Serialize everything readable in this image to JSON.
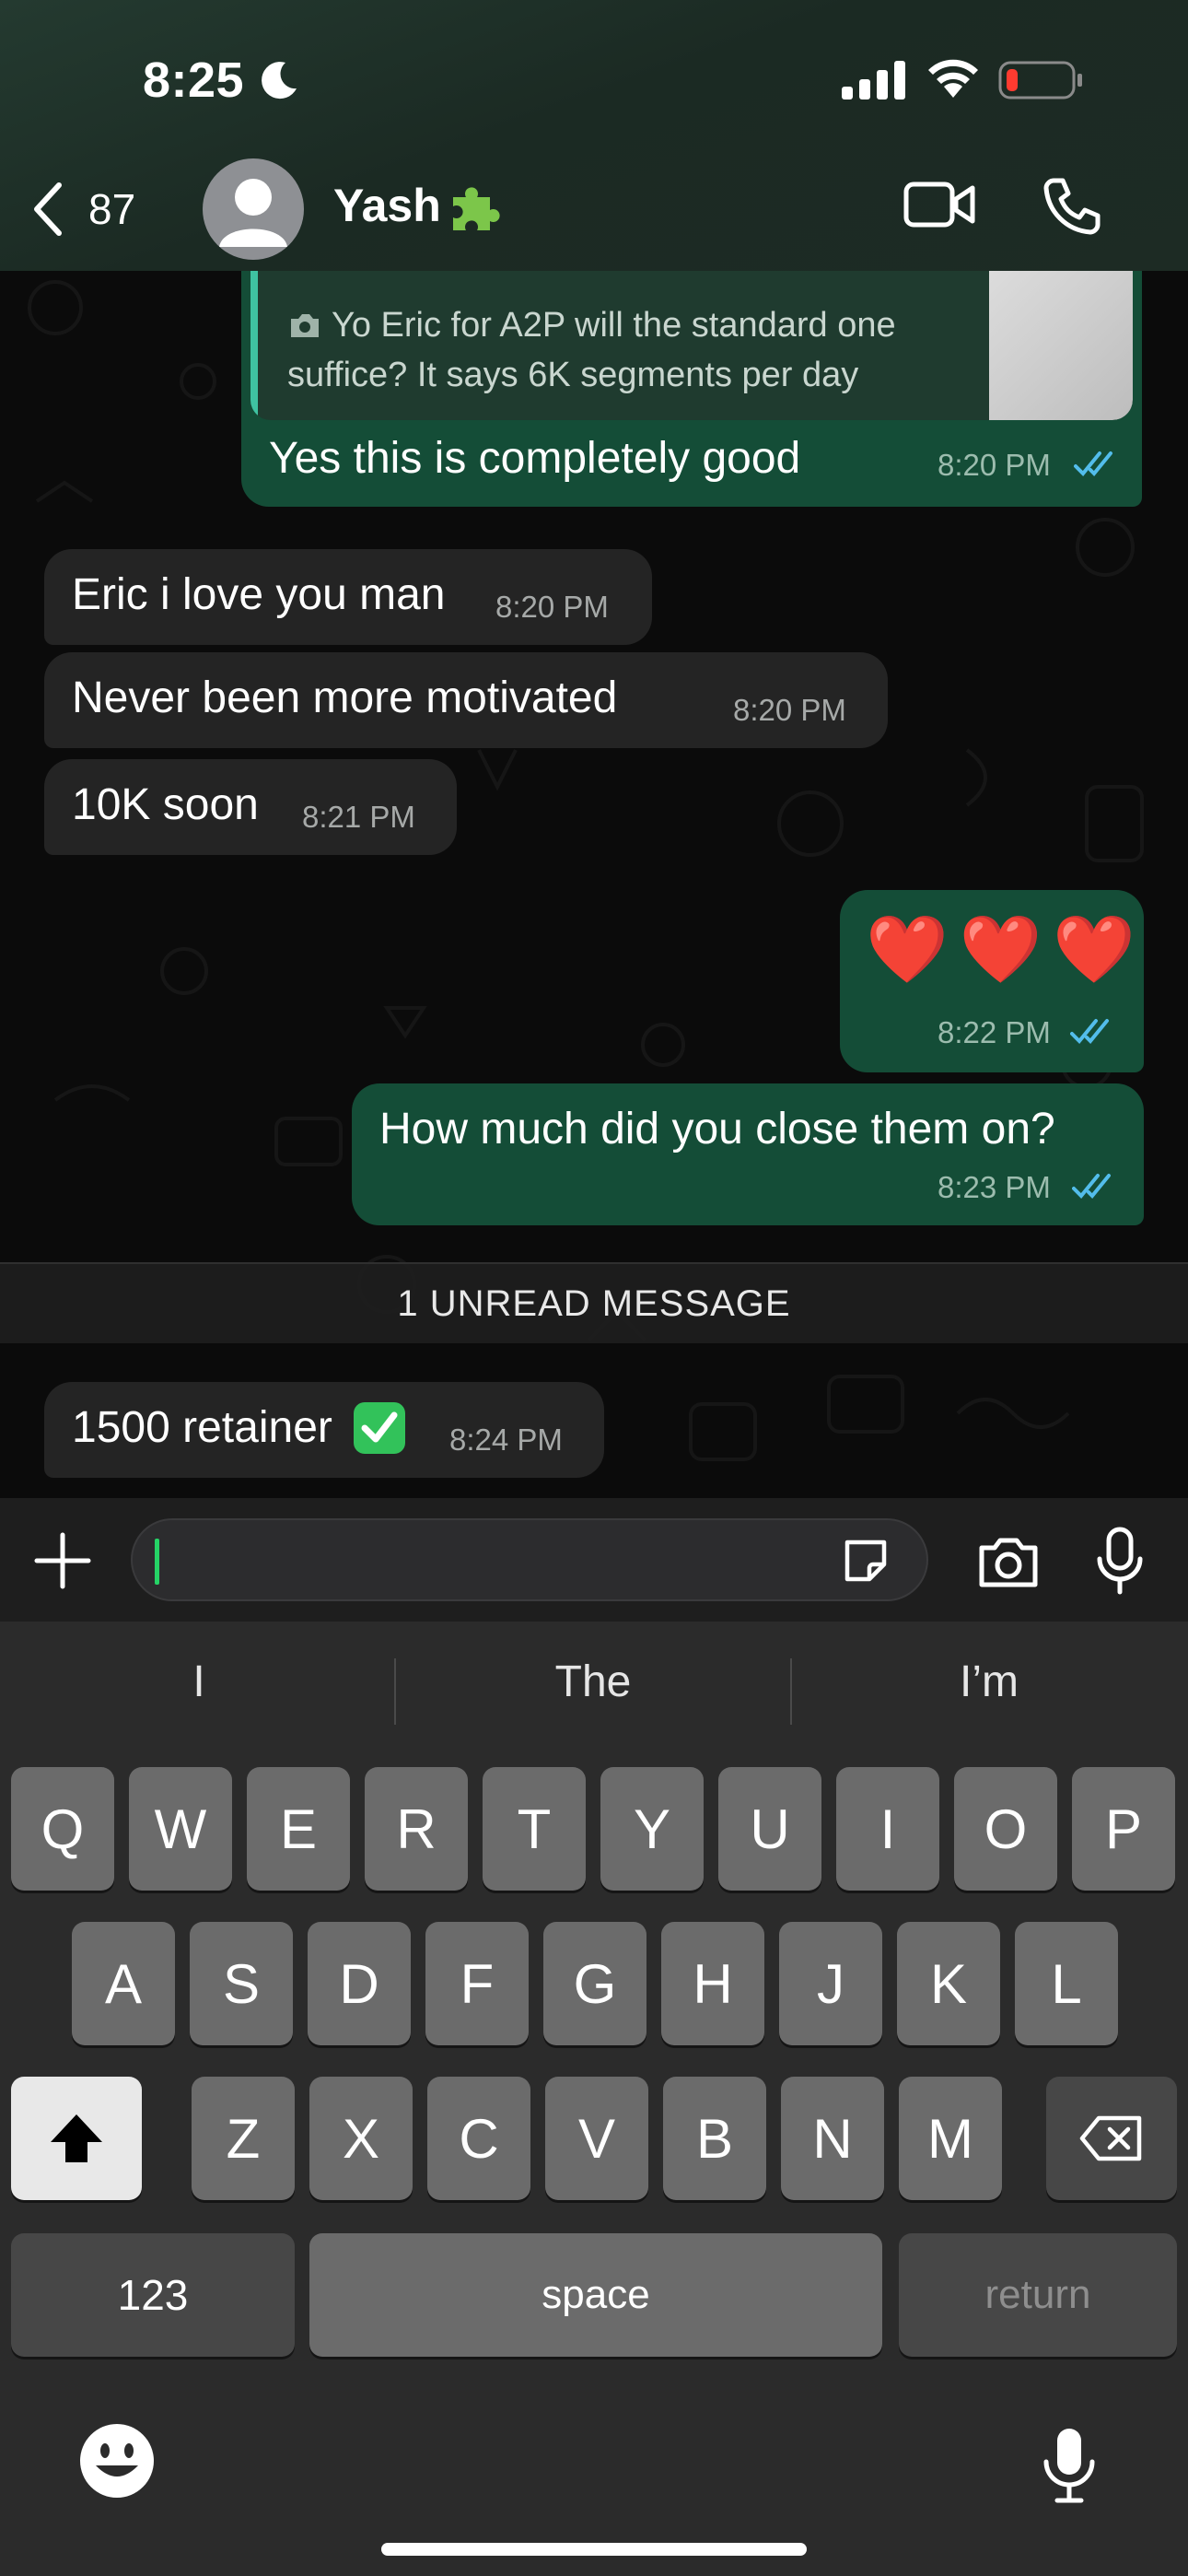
{
  "status_bar": {
    "time": "8:25"
  },
  "header": {
    "back_count": "87",
    "contact_name": "Yash"
  },
  "messages": [
    {
      "reply_line1": "Yo Eric for A2P will the standard one",
      "reply_line2": "suffice? It says 6K segments per day",
      "text": "Yes this is completely good",
      "time": "8:20 PM"
    },
    {
      "text": "Eric i love you man",
      "time": "8:20 PM"
    },
    {
      "text": "Never been more motivated",
      "time": "8:20 PM"
    },
    {
      "text": "10K soon",
      "time": "8:21 PM"
    },
    {
      "text": "❤️ ❤️ ❤️",
      "time": "8:22 PM"
    },
    {
      "text": "How much did you close them on?",
      "time": "8:23 PM"
    },
    {
      "text": "1500 retainer",
      "time": "8:24 PM"
    }
  ],
  "unread_divider": "1 UNREAD MESSAGE",
  "input": {
    "value": ""
  },
  "keyboard": {
    "suggestions": [
      "I",
      "The",
      "I’m"
    ],
    "row1": [
      "Q",
      "W",
      "E",
      "R",
      "T",
      "Y",
      "U",
      "I",
      "O",
      "P"
    ],
    "row2": [
      "A",
      "S",
      "D",
      "F",
      "G",
      "H",
      "J",
      "K",
      "L"
    ],
    "row3": [
      "Z",
      "X",
      "C",
      "V",
      "B",
      "N",
      "M"
    ],
    "numbers_label": "123",
    "space_label": "space",
    "return_label": "return"
  },
  "colors": {
    "outgoing_bubble": "#144d37",
    "incoming_bubble": "#242424",
    "read_ticks": "#53bdeb",
    "accent": "#25d366"
  }
}
